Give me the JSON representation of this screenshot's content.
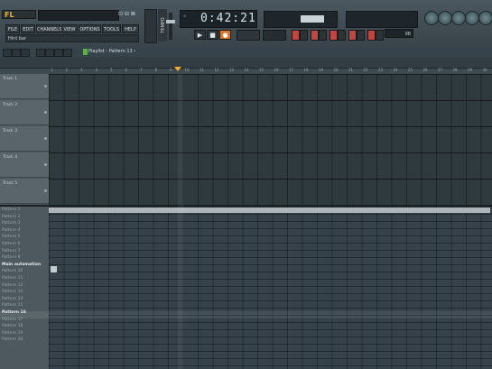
{
  "app": {
    "logo": "FL",
    "mini_buttons": "⊡ ⊟ ⊠"
  },
  "menu": [
    "FILE",
    "EDIT",
    "CHANNELS",
    "VIEW",
    "OPTIONS",
    "TOOLS",
    "HELP"
  ],
  "hint_bar": "Hint bar",
  "tempo_label": "TEMPO",
  "transport": {
    "time": "0:42:21",
    "play": "▶",
    "stop": "■",
    "record": "●"
  },
  "cpu": "98",
  "playlist": {
    "title": "Playlist - Pattern 13 ›"
  },
  "tracks": [
    "Track 1",
    "Track 2",
    "Track 3",
    "Track 4",
    "Track 5"
  ],
  "patterns": [
    "Pattern 1",
    "Pattern 2",
    "Pattern 3",
    "Pattern 4",
    "Pattern 5",
    "Pattern 6",
    "Pattern 7",
    "Pattern 8",
    "Main automation",
    "Pattern 10",
    "Pattern 11",
    "Pattern 12",
    "Pattern 13",
    "Pattern 14",
    "Pattern 15",
    "Pattern 16",
    "Pattern 17",
    "Pattern 18",
    "Pattern 19",
    "Pattern 20"
  ],
  "selected_pattern": "Pattern 16",
  "ruler": [
    "1",
    "2",
    "3",
    "4",
    "5",
    "6",
    "7",
    "8",
    "9",
    "10",
    "11",
    "12",
    "13",
    "14",
    "15",
    "16",
    "17",
    "18",
    "19",
    "20",
    "21",
    "22",
    "23",
    "24",
    "25",
    "26",
    "27",
    "28",
    "29",
    "30"
  ],
  "colors": {
    "accent": "#d8792a",
    "marker": "#f0b02a"
  }
}
